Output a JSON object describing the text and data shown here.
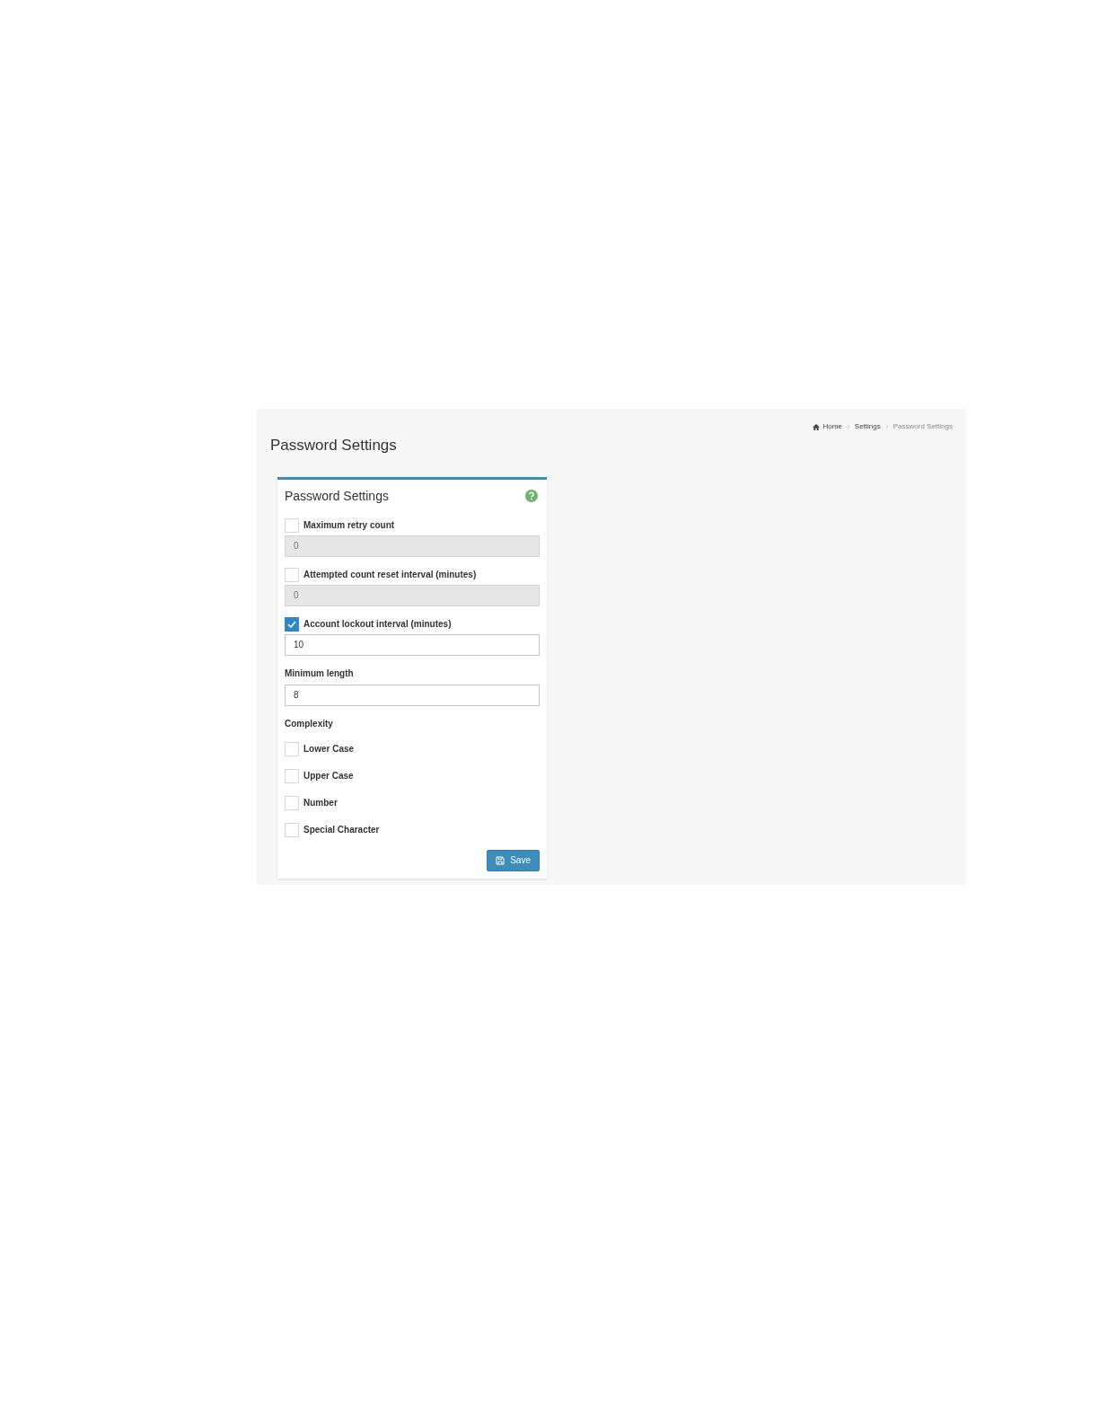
{
  "breadcrumb": [
    {
      "label": "Home",
      "kind": "home"
    },
    {
      "label": "Settings",
      "kind": "link"
    },
    {
      "label": "Password Settings",
      "kind": "current"
    }
  ],
  "page_title": "Password Settings",
  "card": {
    "title": "Password Settings",
    "fields": [
      {
        "kind": "checkbox_field",
        "label": "Maximum retry count",
        "checked": false,
        "value": "0",
        "disabled": true
      },
      {
        "kind": "checkbox_field",
        "label": "Attempted count reset interval (minutes)",
        "checked": false,
        "value": "0",
        "disabled": true
      },
      {
        "kind": "checkbox_field",
        "label": "Account lockout interval (minutes)",
        "checked": true,
        "value": "10",
        "disabled": false
      },
      {
        "kind": "field",
        "label": "Minimum length",
        "value": "8",
        "disabled": false
      }
    ],
    "complexity": {
      "label": "Complexity",
      "options": [
        {
          "label": "Lower Case",
          "checked": false
        },
        {
          "label": "Upper Case",
          "checked": false
        },
        {
          "label": "Number",
          "checked": false
        },
        {
          "label": "Special Character",
          "checked": false
        }
      ]
    },
    "save_button": "Save"
  }
}
